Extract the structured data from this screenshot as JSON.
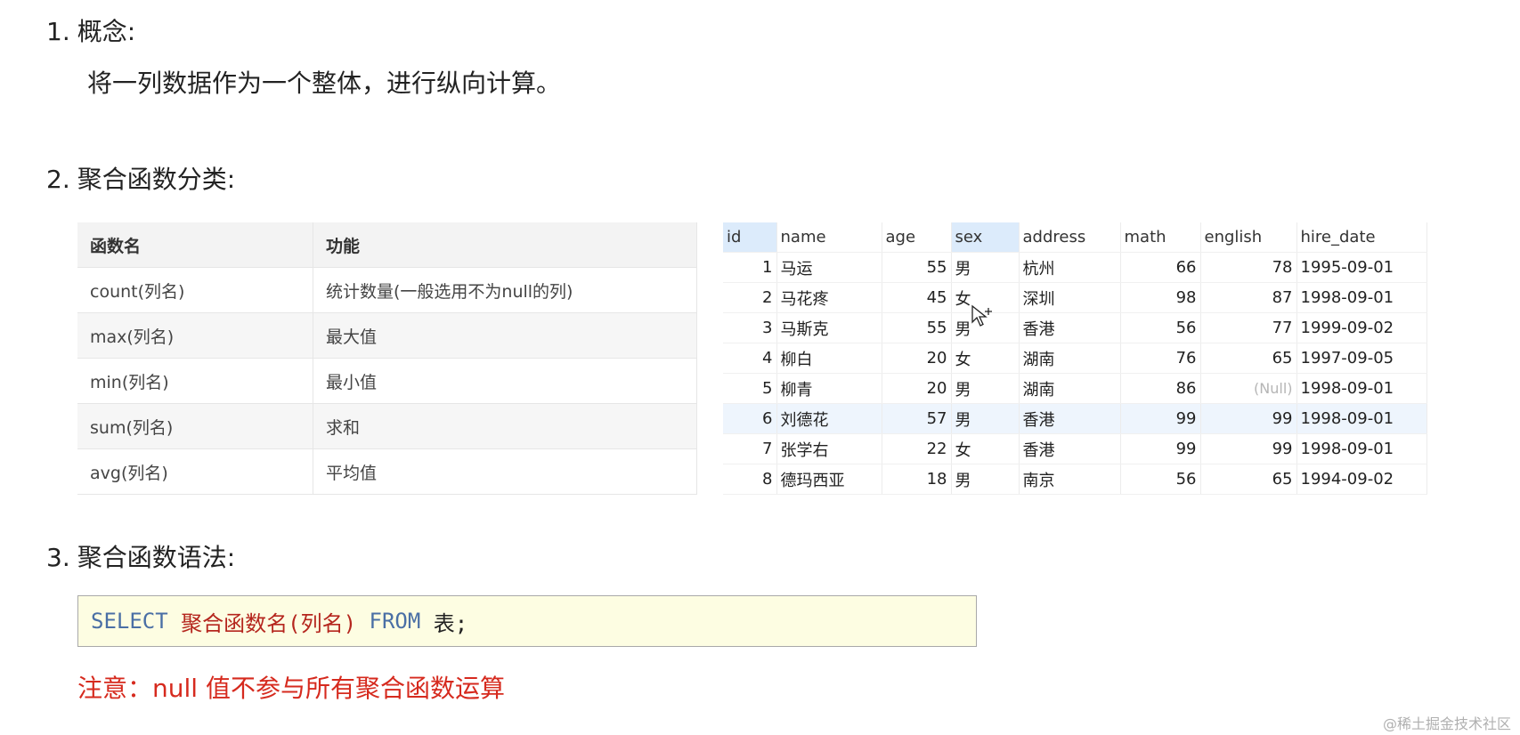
{
  "section1": {
    "num": "1.",
    "title": "概念:",
    "text": "将一列数据作为一个整体，进行纵向计算。"
  },
  "section2": {
    "num": "2.",
    "title": "聚合函数分类:"
  },
  "func_table": {
    "headers": [
      "函数名",
      "功能"
    ],
    "rows": [
      [
        "count(列名)",
        "统计数量(一般选用不为null的列)"
      ],
      [
        "max(列名)",
        "最大值"
      ],
      [
        "min(列名)",
        "最小值"
      ],
      [
        "sum(列名)",
        "求和"
      ],
      [
        "avg(列名)",
        "平均值"
      ]
    ]
  },
  "data_grid": {
    "headers": [
      "id",
      "name",
      "age",
      "sex",
      "address",
      "math",
      "english",
      "hire_date"
    ],
    "rows": [
      [
        "1",
        "马运",
        "55",
        "男",
        "杭州",
        "66",
        "78",
        "1995-09-01"
      ],
      [
        "2",
        "马花疼",
        "45",
        "女",
        "深圳",
        "98",
        "87",
        "1998-09-01"
      ],
      [
        "3",
        "马斯克",
        "55",
        "男",
        "香港",
        "56",
        "77",
        "1999-09-02"
      ],
      [
        "4",
        "柳白",
        "20",
        "女",
        "湖南",
        "76",
        "65",
        "1997-09-05"
      ],
      [
        "5",
        "柳青",
        "20",
        "男",
        "湖南",
        "86",
        "(Null)",
        "1998-09-01"
      ],
      [
        "6",
        "刘德花",
        "57",
        "男",
        "香港",
        "99",
        "99",
        "1998-09-01"
      ],
      [
        "7",
        "张学右",
        "22",
        "女",
        "香港",
        "99",
        "99",
        "1998-09-01"
      ],
      [
        "8",
        "德玛西亚",
        "18",
        "男",
        "南京",
        "56",
        "65",
        "1994-09-02"
      ]
    ]
  },
  "section3": {
    "num": "3.",
    "title": "聚合函数语法:"
  },
  "syntax": {
    "select": "SELECT",
    "func": "聚合函数名(列名)",
    "from": "FROM",
    "table": "表;"
  },
  "note": "注意：null 值不参与所有聚合函数运算",
  "watermark": "@稀土掘金技术社区",
  "colors": {
    "keyword": "#4a6fa5",
    "highlight_red": "#b5261e",
    "note_red": "#d62a1e",
    "syntax_bg": "#fdfde2"
  }
}
